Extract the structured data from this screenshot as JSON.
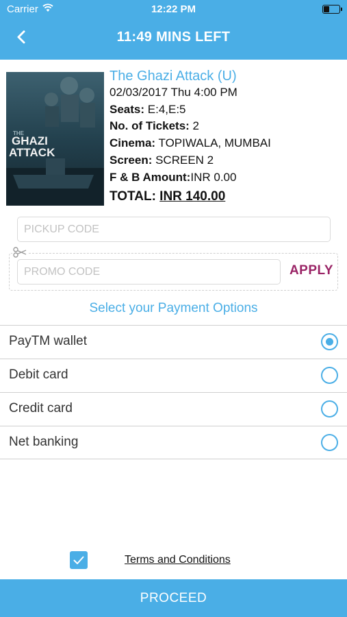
{
  "status_bar": {
    "carrier": "Carrier",
    "time": "12:22 PM"
  },
  "header": {
    "timer_title": "11:49 MINS LEFT",
    "back_icon": "chevron-left-icon"
  },
  "poster": {
    "title_line1": "THE",
    "title_line2": "GHAZI",
    "title_line3": "ATTACK"
  },
  "booking": {
    "movie_title": "The Ghazi Attack (U)",
    "datetime": "02/03/2017 Thu 4:00 PM",
    "seats_label": "Seats:",
    "seats_value": " E:4,E:5",
    "tickets_label": "No. of Tickets:",
    "tickets_value": " 2",
    "cinema_label": "Cinema:",
    "cinema_value": " TOPIWALA, MUMBAI",
    "screen_label": "Screen:",
    "screen_value": " SCREEN 2",
    "fb_label": "F & B Amount:",
    "fb_value": "INR 0.00",
    "total_label": "TOTAL: ",
    "total_value": "INR 140.00"
  },
  "pickup": {
    "placeholder": "PICKUP CODE",
    "value": ""
  },
  "promo": {
    "placeholder": "PROMO CODE",
    "value": "",
    "apply_label": "APPLY",
    "icon": "scissors-icon"
  },
  "payment": {
    "heading": "Select your Payment Options",
    "options": [
      {
        "label": "PayTM wallet",
        "selected": true
      },
      {
        "label": "Debit card",
        "selected": false
      },
      {
        "label": "Credit card",
        "selected": false
      },
      {
        "label": "Net banking",
        "selected": false
      }
    ]
  },
  "terms": {
    "checked": true,
    "link_label": "Terms and Conditions"
  },
  "footer": {
    "proceed_label": "PROCEED"
  },
  "colors": {
    "accent": "#4aaee6",
    "apply": "#9a2466"
  }
}
